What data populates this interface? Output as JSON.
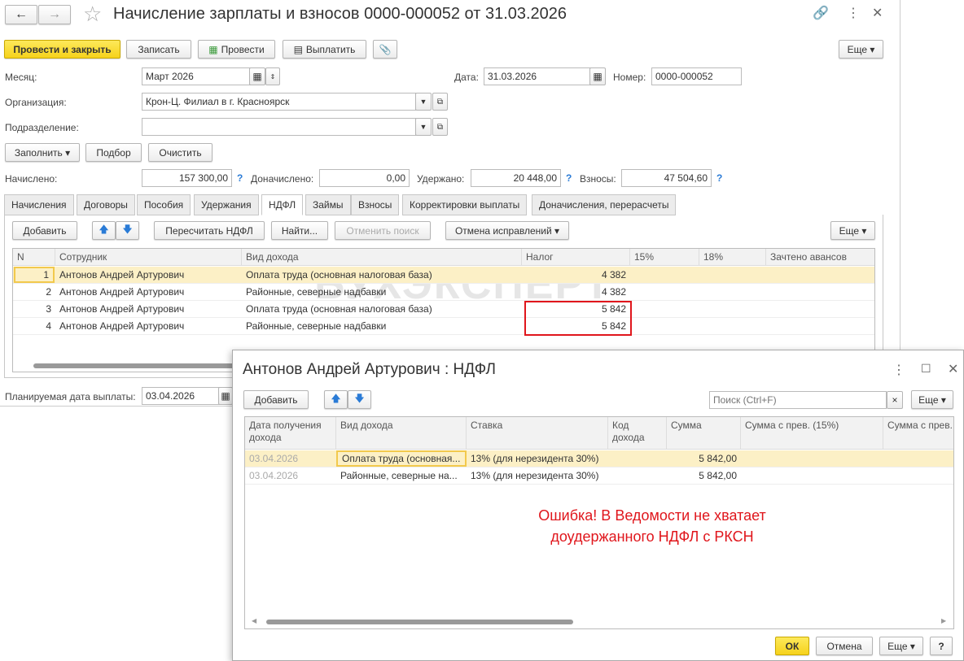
{
  "window": {
    "title": "Начисление зарплаты и взносов 0000-000052 от 31.03.2026"
  },
  "toolbar": {
    "post_close": "Провести и закрыть",
    "save": "Записать",
    "post": "Провести",
    "pay": "Выплатить",
    "more": "Еще"
  },
  "fields": {
    "month_label": "Месяц:",
    "month": "Март 2026",
    "date_label": "Дата:",
    "date": "31.03.2026",
    "number_label": "Номер:",
    "number": "0000-000052",
    "org_label": "Организация:",
    "org": "Крон-Ц. Филиал в г. Красноярск",
    "dept_label": "Подразделение:",
    "dept": ""
  },
  "fill": {
    "fill": "Заполнить",
    "pick": "Подбор",
    "clear": "Очистить"
  },
  "totals": {
    "accrued_label": "Начислено:",
    "accrued": "157 300,00",
    "extra_label": "Доначислено:",
    "extra": "0,00",
    "withheld_label": "Удержано:",
    "withheld": "20 448,00",
    "contrib_label": "Взносы:",
    "contrib": "47 504,60",
    "q": "?"
  },
  "tabs": [
    "Начисления",
    "Договоры",
    "Пособия",
    "Удержания",
    "НДФЛ",
    "Займы",
    "Взносы",
    "Корректировки выплаты",
    "Доначисления, перерасчеты"
  ],
  "tab_toolbar": {
    "add": "Добавить",
    "recalc": "Пересчитать НДФЛ",
    "find": "Найти...",
    "cancel_search": "Отменить поиск",
    "cancel_fix": "Отмена исправлений",
    "more": "Еще"
  },
  "table": {
    "columns": [
      "N",
      "Сотрудник",
      "Вид дохода",
      "Налог",
      "15%",
      "18%",
      "Зачтено авансов"
    ],
    "rows": [
      [
        "1",
        "Антонов Андрей Артурович",
        "Оплата труда (основная налоговая база)",
        "4 382"
      ],
      [
        "2",
        "Антонов Андрей Артурович",
        "Районные, северные надбавки",
        "4 382"
      ],
      [
        "3",
        "Антонов Андрей Артурович",
        "Оплата труда (основная налоговая база)",
        "5 842"
      ],
      [
        "4",
        "Антонов Андрей Артурович",
        "Районные, северные надбавки",
        "5 842"
      ]
    ]
  },
  "watermark": "БУХЭКСПЕРТ",
  "plan_date": {
    "label": "Планируемая дата выплаты:",
    "value": "03.04.2026"
  },
  "dialog": {
    "title": "Антонов Андрей Артурович : НДФЛ",
    "add": "Добавить",
    "search_placeholder": "Поиск (Ctrl+F)",
    "more": "Еще",
    "columns": [
      "Дата получения дохода",
      "Вид дохода",
      "Ставка",
      "Код дохода",
      "Сумма",
      "Сумма с прев. (15%)",
      "Сумма с прев."
    ],
    "rows": [
      [
        "03.04.2026",
        "Оплата труда (основная...",
        "13% (для нерезидента 30%)",
        "",
        "5 842,00"
      ],
      [
        "03.04.2026",
        "Районные, северные на...",
        "13% (для нерезидента 30%)",
        "",
        "5 842,00"
      ]
    ],
    "note": [
      "Ошибка! В Ведомости не хватает",
      "доудержанного  НДФЛ с РКСН"
    ],
    "ok": "ОК",
    "cancel": "Отмена",
    "help": "?"
  }
}
